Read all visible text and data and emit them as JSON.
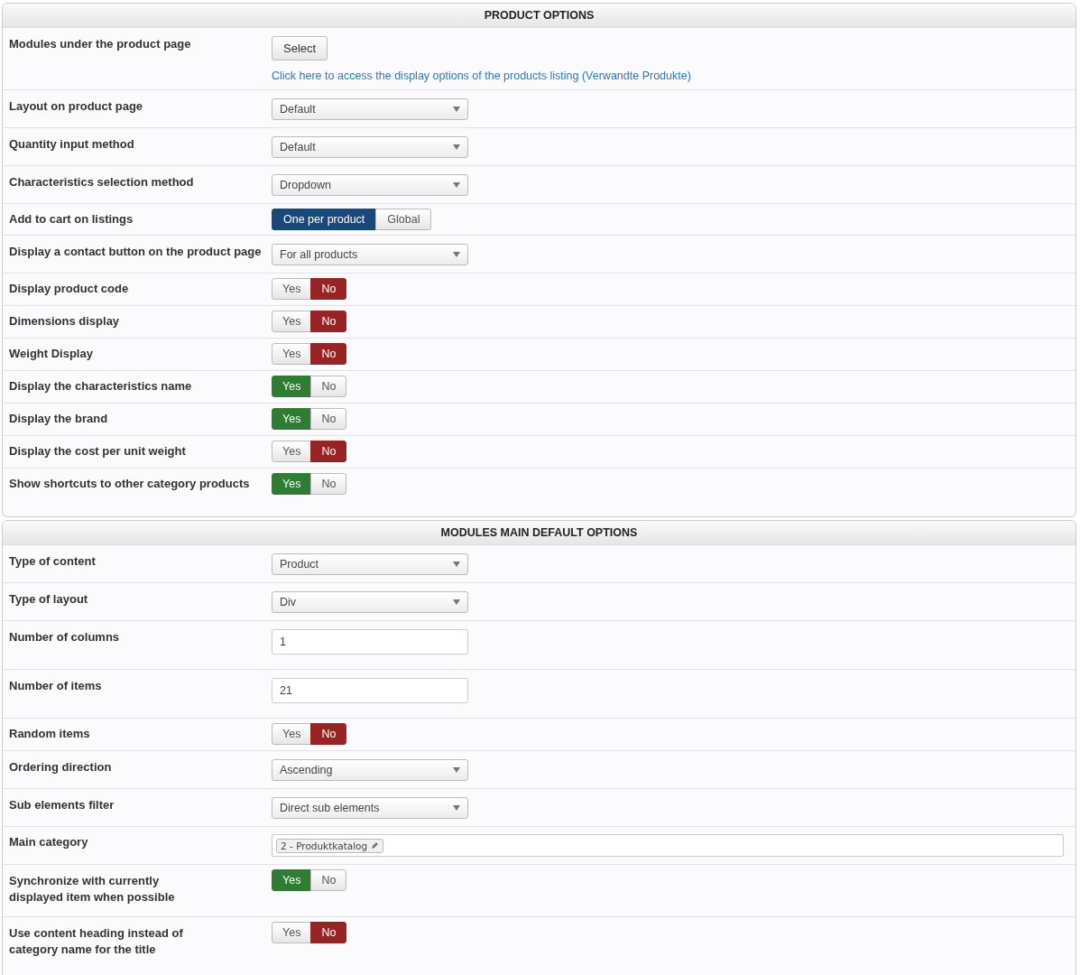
{
  "panels": [
    {
      "title": "PRODUCT OPTIONS",
      "rows": [
        {
          "kind": "button",
          "label": "Modules under the product page",
          "button": "Select",
          "link": "Click here to access the display options of the products listing (Verwandte Produkte)"
        },
        {
          "kind": "select",
          "label": "Layout on product page",
          "value": "Default"
        },
        {
          "kind": "select",
          "label": "Quantity input method",
          "value": "Default"
        },
        {
          "kind": "select",
          "label": "Characteristics selection method",
          "value": "Dropdown"
        },
        {
          "kind": "choice",
          "label": "Add to cart on listings",
          "options": [
            {
              "label": "One per product",
              "selected": true
            },
            {
              "label": "Global",
              "selected": false
            }
          ]
        },
        {
          "kind": "select",
          "label": "Display a contact button on the product page",
          "value": "For all products"
        },
        {
          "kind": "yesno",
          "label": "Display product code",
          "options": [
            {
              "label": "Yes",
              "selected": false
            },
            {
              "label": "No",
              "selected": true
            }
          ]
        },
        {
          "kind": "yesno",
          "label": "Dimensions display",
          "options": [
            {
              "label": "Yes",
              "selected": false
            },
            {
              "label": "No",
              "selected": true
            }
          ]
        },
        {
          "kind": "yesno",
          "label": "Weight Display",
          "options": [
            {
              "label": "Yes",
              "selected": false
            },
            {
              "label": "No",
              "selected": true
            }
          ]
        },
        {
          "kind": "yesno",
          "label": "Display the characteristics name",
          "options": [
            {
              "label": "Yes",
              "selected": true
            },
            {
              "label": "No",
              "selected": false
            }
          ]
        },
        {
          "kind": "yesno",
          "label": "Display the brand",
          "options": [
            {
              "label": "Yes",
              "selected": true
            },
            {
              "label": "No",
              "selected": false
            }
          ]
        },
        {
          "kind": "yesno",
          "label": "Display the cost per unit weight",
          "options": [
            {
              "label": "Yes",
              "selected": false
            },
            {
              "label": "No",
              "selected": true
            }
          ]
        },
        {
          "kind": "yesno",
          "label": "Show shortcuts to other category products",
          "options": [
            {
              "label": "Yes",
              "selected": true
            },
            {
              "label": "No",
              "selected": false
            }
          ]
        }
      ]
    },
    {
      "title": "MODULES MAIN DEFAULT OPTIONS",
      "rows": [
        {
          "kind": "select",
          "label": "Type of content",
          "value": "Product"
        },
        {
          "kind": "select",
          "label": "Type of layout",
          "value": "Div"
        },
        {
          "kind": "text",
          "label": "Number of columns",
          "value": "1"
        },
        {
          "kind": "text",
          "label": "Number of items",
          "value": "21"
        },
        {
          "kind": "yesno",
          "label": "Random items",
          "options": [
            {
              "label": "Yes",
              "selected": false
            },
            {
              "label": "No",
              "selected": true
            }
          ]
        },
        {
          "kind": "select",
          "label": "Ordering direction",
          "value": "Ascending"
        },
        {
          "kind": "select",
          "label": "Sub elements filter",
          "value": "Direct sub elements"
        },
        {
          "kind": "tags",
          "label": "Main category",
          "tags": [
            "2 - Produktkatalog"
          ]
        },
        {
          "kind": "yesno",
          "label": "Synchronize with currently displayed item when possible",
          "options": [
            {
              "label": "Yes",
              "selected": true
            },
            {
              "label": "No",
              "selected": false
            }
          ]
        },
        {
          "kind": "yesno",
          "label": "Use content heading instead of category name for the title",
          "options": [
            {
              "label": "Yes",
              "selected": false
            },
            {
              "label": "No",
              "selected": true
            }
          ]
        }
      ]
    }
  ]
}
